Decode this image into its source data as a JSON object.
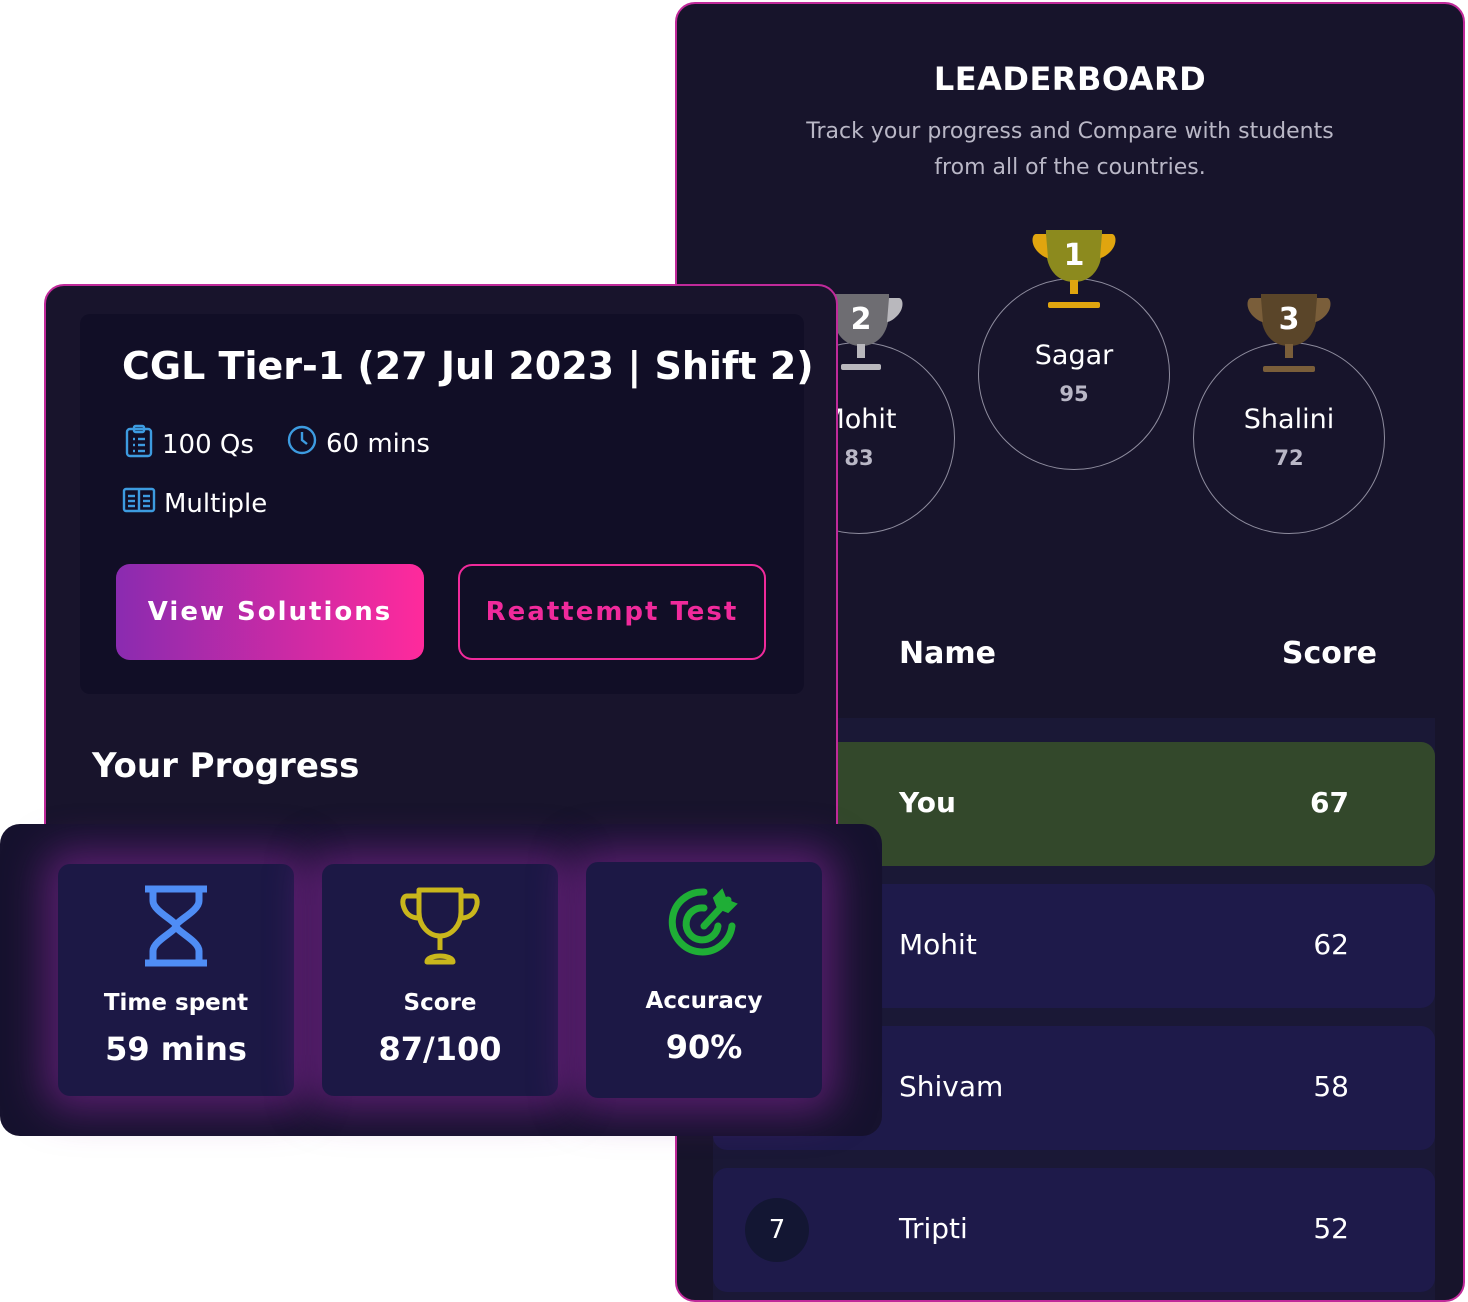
{
  "leaderboard": {
    "title": "LEADERBOARD",
    "subtitle": "Track your progress and Compare with students from all of the countries.",
    "podium": [
      {
        "rank": "1",
        "name": "Sagar",
        "score": "95",
        "trophy_color": "#8c8a1e",
        "trophy_accent": "#e0a50f"
      },
      {
        "rank": "2",
        "name": "Mohit",
        "score": "83",
        "trophy_color": "#6e6d72",
        "trophy_accent": "#b9b8bd"
      },
      {
        "rank": "3",
        "name": "Shalini",
        "score": "72",
        "trophy_color": "#5a4529",
        "trophy_accent": "#7a5e3a"
      }
    ],
    "columns": {
      "name": "Name",
      "score": "Score"
    },
    "rows": [
      {
        "name": "You",
        "score": "67",
        "rank": ""
      },
      {
        "name": "Mohit",
        "score": "62",
        "rank": ""
      },
      {
        "name": "Shivam",
        "score": "58",
        "rank": ""
      },
      {
        "name": "Tripti",
        "score": "52",
        "rank": "7"
      }
    ]
  },
  "test": {
    "title": "CGL Tier-1 (27 Jul 2023 | Shift 2)",
    "questions": "100 Qs",
    "duration": "60 mins",
    "language": "Multiple",
    "view_solutions": "View Solutions",
    "reattempt": "Reattempt Test"
  },
  "progress": {
    "title": "Your Progress",
    "stats": [
      {
        "label": "Time spent",
        "value": "59 mins",
        "icon": "hourglass-icon",
        "color": "#4f8df5"
      },
      {
        "label": "Score",
        "value": "87/100",
        "icon": "trophy-icon",
        "color": "#c9b61c"
      },
      {
        "label": "Accuracy",
        "value": "90%",
        "icon": "target-icon",
        "color": "#1fae36"
      }
    ]
  },
  "colors": {
    "accent": "#f02a9b",
    "highlight_row": "#33482b",
    "background": "#17142b"
  }
}
